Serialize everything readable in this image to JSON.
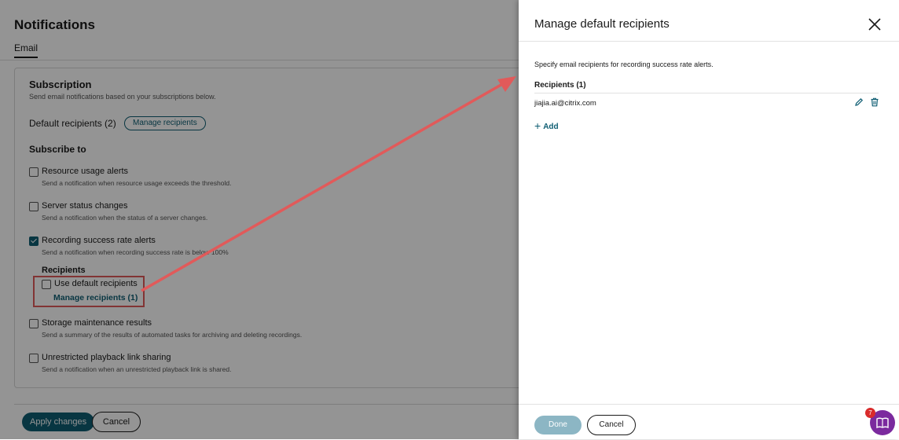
{
  "page": {
    "title": "Notifications",
    "tab": "Email",
    "subscription": {
      "title": "Subscription",
      "description": "Send email notifications based on your subscriptions below.",
      "default_recipients_label": "Default recipients (2)",
      "manage_recipients_button": "Manage recipients"
    },
    "subscribe_to_label": "Subscribe to",
    "options": [
      {
        "label": "Resource usage alerts",
        "description": "Send a notification when resource usage exceeds the threshold.",
        "checked": false
      },
      {
        "label": "Server status changes",
        "description": "Send a notification when the status of a server changes.",
        "checked": false
      },
      {
        "label": "Recording success rate alerts",
        "description": "Send a notification when recording success rate is below 100%",
        "checked": true
      },
      {
        "label": "Storage maintenance results",
        "description": "Send a summary of the results of automated tasks for archiving and deleting recordings.",
        "checked": false
      },
      {
        "label": "Unrestricted playback link sharing",
        "description": "Send a notification when an unrestricted playback link is shared.",
        "checked": false
      }
    ],
    "recipients_heading": "Recipients",
    "use_default_recipients": {
      "label": "Use default recipients",
      "checked": false
    },
    "manage_recipients_link": "Manage recipients (1)",
    "apply_button": "Apply changes",
    "cancel_button": "Cancel"
  },
  "panel": {
    "title": "Manage default recipients",
    "description": "Specify email recipients for recording success rate alerts.",
    "recipients_heading": "Recipients (1)",
    "recipients": [
      "jiajia.ai@citrix.com"
    ],
    "add_button": "Add",
    "done_button": "Done",
    "cancel_button": "Cancel"
  },
  "help": {
    "badge_count": "7"
  },
  "colors": {
    "accent": "#0f5e73",
    "annotation": "#e15a5a",
    "help_fab": "#7b2a9e"
  }
}
